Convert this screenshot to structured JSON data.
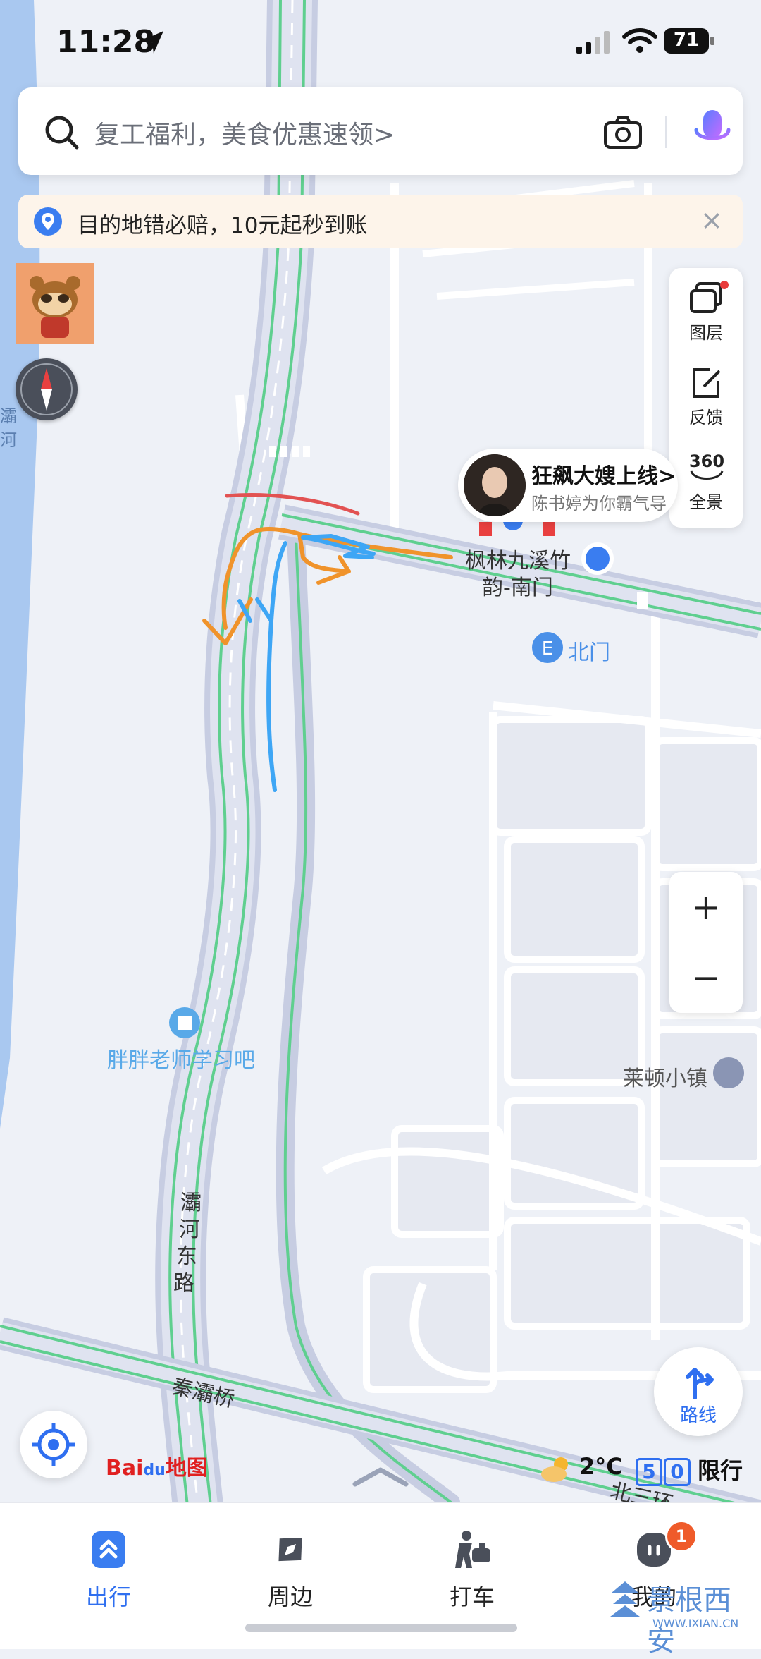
{
  "status_bar": {
    "time": "11:28",
    "battery": "71"
  },
  "search": {
    "placeholder": "复工福利，美食优惠速领>"
  },
  "banner": {
    "text": "目的地错必赔，10元起秒到账"
  },
  "tools": [
    {
      "label": "图层",
      "icon": "layers-icon"
    },
    {
      "label": "反馈",
      "icon": "feedback-icon"
    },
    {
      "label": "全景",
      "icon": "panorama-360-icon",
      "glyph": "360"
    }
  ],
  "promo": {
    "title": "狂飙大嫂上线>",
    "subtitle": "陈书婷为你霸气导"
  },
  "map_labels": {
    "poi_destination": "枫林九溪竹",
    "poi_destination_line2": "韵-南门",
    "north_gate": "北门",
    "study_spot": "胖胖老师学习吧",
    "laidun_town": "莱顿小镇",
    "road_bahe": "灞",
    "road_bahe2": "河",
    "road_bahe3": "东",
    "road_bahe4": "路",
    "bridge": "秦灞桥",
    "north_ring": "北三环",
    "river_left": "灞",
    "river_left2": "河"
  },
  "zoom": {
    "in": "+",
    "out": "−"
  },
  "route_button": {
    "label": "路线"
  },
  "brand": {
    "bai": "Bai",
    "du": "du",
    "map": "地图"
  },
  "weather": {
    "temp": "2°C"
  },
  "restriction": {
    "num1": "5",
    "num2": "0",
    "label": "限行"
  },
  "bottom_nav": [
    {
      "label": "出行",
      "active": true
    },
    {
      "label": "周边"
    },
    {
      "label": "打车"
    },
    {
      "label": "我的",
      "badge": "1"
    }
  ],
  "watermark": {
    "name": "景根西安",
    "url": "WWW.IXIAN.CN"
  },
  "colors": {
    "accent": "#2f6ff0",
    "road": "#c5cbe0",
    "green_line": "#5fcf8f",
    "water": "#9dc3f0",
    "orange_draw": "#f0932b",
    "blue_draw": "#3ea6f5"
  }
}
